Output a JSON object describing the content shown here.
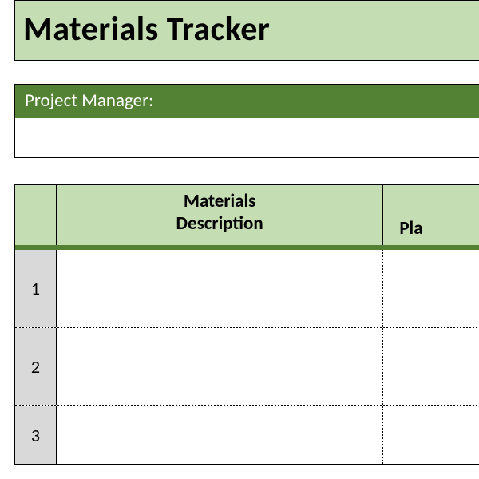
{
  "header": {
    "title": "Materials Tracker"
  },
  "fields": {
    "project_manager_label": "Project Manager:",
    "project_manager_value": ""
  },
  "table": {
    "columns": {
      "rownum": "",
      "description": "Materials\nDescription",
      "planned": "Pla"
    },
    "rows": [
      {
        "num": "1",
        "description": "",
        "planned": ""
      },
      {
        "num": "2",
        "description": "",
        "planned": ""
      },
      {
        "num": "3",
        "description": "",
        "planned": ""
      }
    ]
  }
}
